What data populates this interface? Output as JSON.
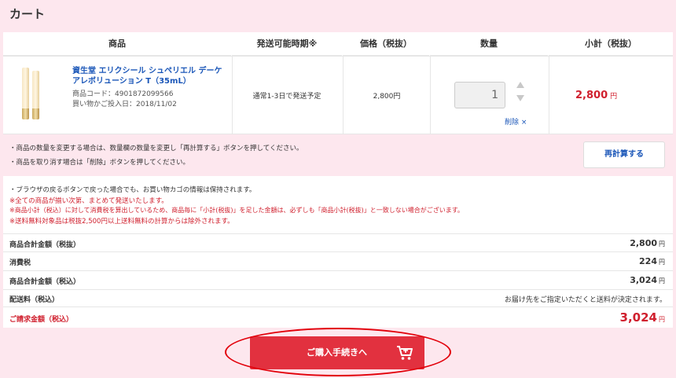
{
  "page": {
    "title": "カート"
  },
  "table": {
    "headers": {
      "product": "商品",
      "ship_time": "発送可能時期※",
      "price": "価格（税抜）",
      "qty": "数量",
      "subtotal": "小計（税抜）"
    }
  },
  "item": {
    "name": "資生堂 エリクシール シュペリエル デーケアレボリューション T（35mL）",
    "code": "商品コード：4901872099566",
    "added": "買い物かご投入日：2018/11/02",
    "ship_time": "通常1-3日で発送予定",
    "price": "2,800円",
    "qty": "1",
    "delete_label": "削除 ×",
    "subtotal": "2,800",
    "subtotal_unit": "円"
  },
  "notes_top": [
    "・商品の数量を変更する場合は、数量欄の数量を変更し「再計算する」ボタンを押してください。",
    "・商品を取り消す場合は「削除」ボタンを押してください。"
  ],
  "recalc_label": "再計算する",
  "notes_bottom": {
    "line1": "・ブラウザの戻るボタンで戻った場合でも、お買い物カゴの情報は保持されます。",
    "line2": "※全ての商品が揃い次第、まとめて発送いたします。",
    "line3": "※商品小計（税込）に対して消費税を算出しているため、商品毎に「小計(税抜)」を足した金額は、必ずしも「商品小計(税抜)」と一致しない場合がございます。",
    "line4": "※送料無料対象品は税抜2,500円以上送料無料の計算からは除外されます。"
  },
  "totals": {
    "subtotal_ex_label": "商品合計金額（税抜）",
    "subtotal_ex": "2,800",
    "tax_label": "消費税",
    "tax": "224",
    "subtotal_in_label": "商品合計金額（税込）",
    "subtotal_in": "3,024",
    "shipping_label": "配送料（税込）",
    "shipping_note": "お届け先をご指定いただくと送料が決定されます。",
    "billing_label": "ご請求金額（税込）",
    "billing": "3,024",
    "yen": "円"
  },
  "checkout_label": "ご購入手続きへ",
  "colors": {
    "accent": "#e2313f",
    "link": "#1a56b8",
    "pink": "#fde7ee"
  }
}
